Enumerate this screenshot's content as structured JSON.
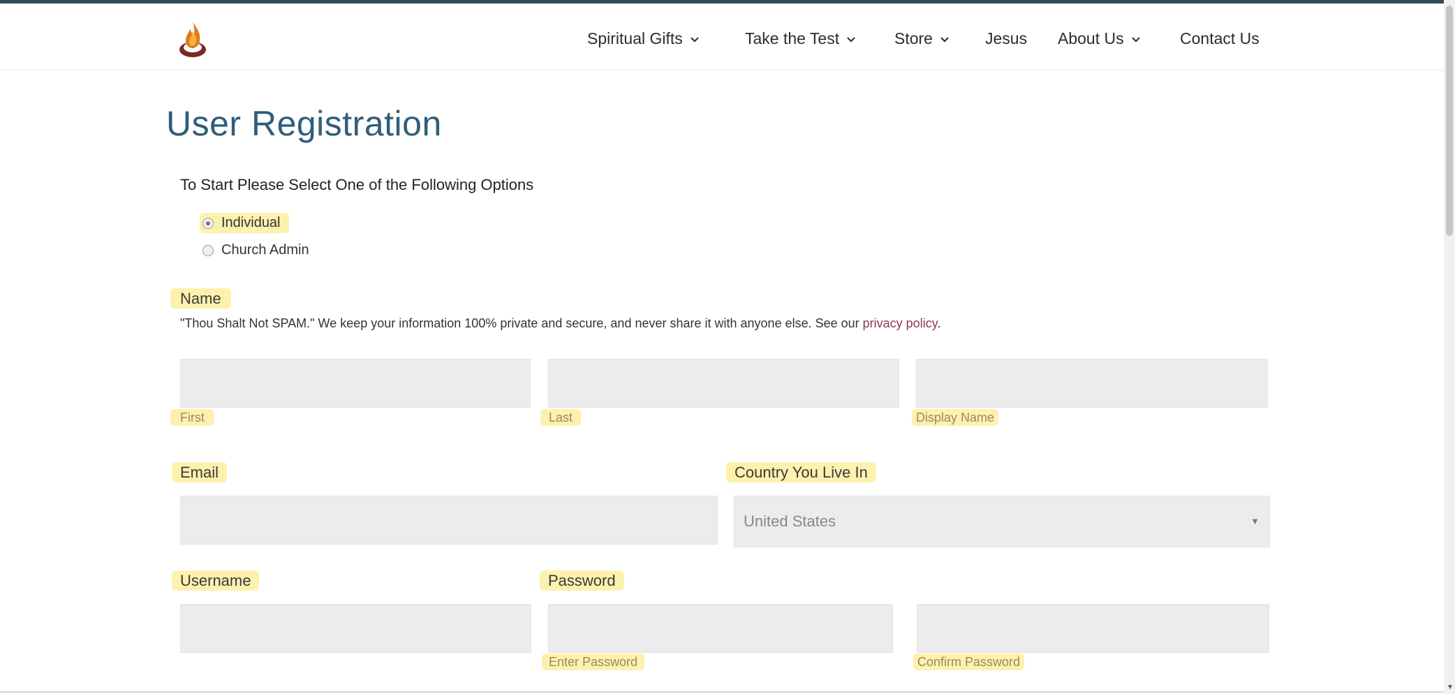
{
  "header": {
    "nav": [
      {
        "label": "Spiritual Gifts",
        "has_dropdown": true
      },
      {
        "label": "Take the Test",
        "has_dropdown": true
      },
      {
        "label": "Store",
        "has_dropdown": true
      },
      {
        "label": "Jesus",
        "has_dropdown": false
      },
      {
        "label": "About Us",
        "has_dropdown": true
      },
      {
        "label": "Contact Us",
        "has_dropdown": false
      }
    ]
  },
  "page": {
    "title": "User Registration",
    "intro": "To Start Please Select One of the Following Options",
    "options": [
      {
        "label": "Individual",
        "selected": true
      },
      {
        "label": "Church Admin",
        "selected": false
      }
    ]
  },
  "form": {
    "name_label": "Name",
    "spam_note": "\"Thou Shalt Not SPAM.\" We keep your information 100% private and secure, and never share it with anyone else. See our ",
    "privacy_link": "privacy policy",
    "period": ".",
    "first_label": "First",
    "last_label": "Last",
    "display_label": "Display Name",
    "email_label": "Email",
    "country_label": "Country You Live In",
    "country_value": "United States",
    "username_label": "Username",
    "password_label": "Password",
    "enter_password_label": "Enter Password",
    "confirm_password_label": "Confirm Password"
  },
  "colors": {
    "accent_blue": "#2f5d7b",
    "topbar": "#2f4b5c",
    "link": "#8a3b4a",
    "highlight": "#fdeea0"
  }
}
